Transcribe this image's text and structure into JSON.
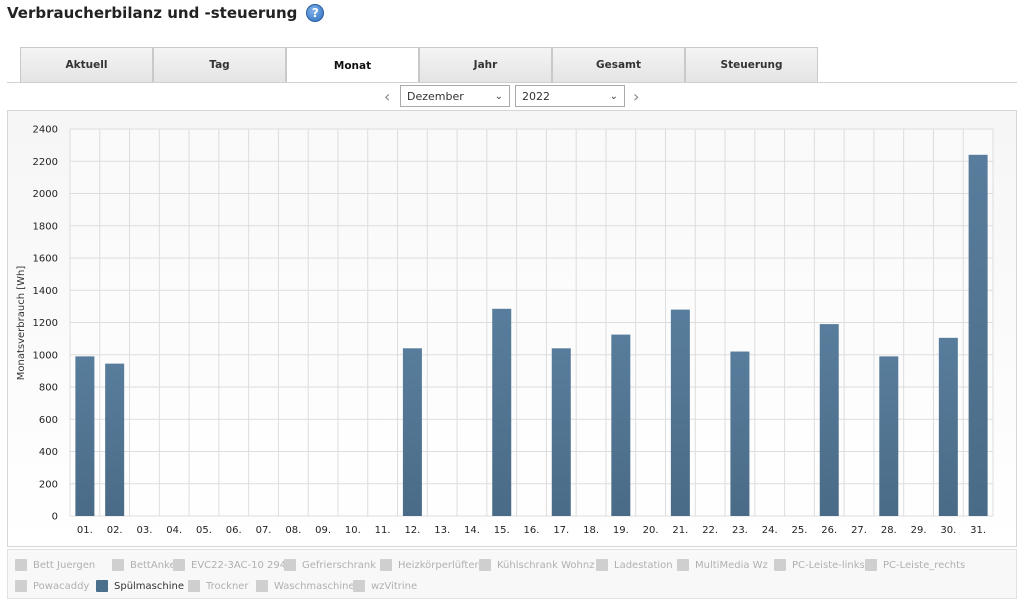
{
  "header": {
    "title": "Verbraucherbilanz und -steuerung",
    "help_icon": "question-circle-icon"
  },
  "tabs": [
    {
      "label": "Aktuell",
      "active": false
    },
    {
      "label": "Tag",
      "active": false
    },
    {
      "label": "Monat",
      "active": true
    },
    {
      "label": "Jahr",
      "active": false
    },
    {
      "label": "Gesamt",
      "active": false
    },
    {
      "label": "Steuerung",
      "active": false
    }
  ],
  "period": {
    "month": "Dezember",
    "year": "2022"
  },
  "colors": {
    "bar": "#587d9c",
    "bar_dark": "#4a6b87",
    "grid": "#dddddd"
  },
  "chart_data": {
    "type": "bar",
    "ylabel": "Monatsverbrauch [Wh]",
    "xlabel": "",
    "ylim": [
      0,
      2400
    ],
    "yticks": [
      0,
      200,
      400,
      600,
      800,
      1000,
      1200,
      1400,
      1600,
      1800,
      2000,
      2200,
      2400
    ],
    "grid": true,
    "categories": [
      "01.",
      "02.",
      "03.",
      "04.",
      "05.",
      "06.",
      "07.",
      "08.",
      "09.",
      "10.",
      "11.",
      "12.",
      "13.",
      "14.",
      "15.",
      "16.",
      "17.",
      "18.",
      "19.",
      "20.",
      "21.",
      "22.",
      "23.",
      "24.",
      "25.",
      "26.",
      "27.",
      "28.",
      "29.",
      "30.",
      "31."
    ],
    "series": [
      {
        "name": "Spülmaschine",
        "values": [
          990,
          945,
          0,
          0,
          0,
          0,
          0,
          0,
          0,
          0,
          0,
          1040,
          0,
          0,
          1285,
          0,
          1040,
          0,
          1125,
          0,
          1280,
          0,
          1020,
          0,
          0,
          1190,
          0,
          990,
          0,
          1105,
          2240
        ]
      }
    ]
  },
  "legend": {
    "items": [
      {
        "label": "Bett Juergen",
        "active": false
      },
      {
        "label": "BettAnke",
        "active": false
      },
      {
        "label": "EVC22-3AC-10 294",
        "active": false
      },
      {
        "label": "Gefrierschrank",
        "active": false
      },
      {
        "label": "Heizkörperlüfter",
        "active": false
      },
      {
        "label": "Kühlschrank Wohnz",
        "active": false
      },
      {
        "label": "Ladestation",
        "active": false
      },
      {
        "label": "MultiMedia Wz",
        "active": false
      },
      {
        "label": "PC-Leiste-links",
        "active": false
      },
      {
        "label": "PC-Leiste_rechts",
        "active": false
      },
      {
        "label": "Powacaddy",
        "active": false
      },
      {
        "label": "Spülmaschine",
        "active": true
      },
      {
        "label": "Trockner",
        "active": false
      },
      {
        "label": "Waschmaschine",
        "active": false
      },
      {
        "label": "wzVitrine",
        "active": false
      }
    ]
  }
}
